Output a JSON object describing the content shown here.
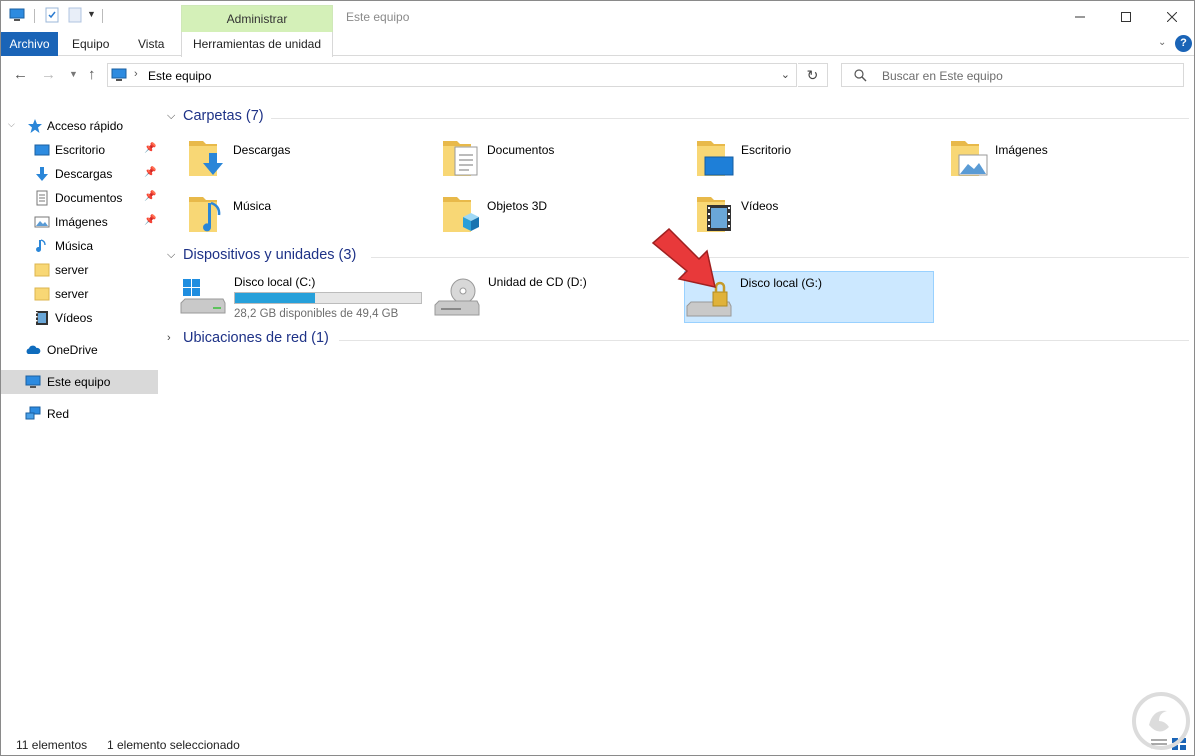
{
  "window": {
    "title": "Este equipo",
    "context_tab": "Administrar",
    "min_icon": "minimize-icon",
    "max_icon": "maximize-icon",
    "close_icon": "close-icon"
  },
  "ribbon": {
    "tabs": [
      "Archivo",
      "Equipo",
      "Vista",
      "Herramientas de unidad"
    ],
    "help": "?"
  },
  "address": {
    "location": "Este equipo",
    "search_placeholder": "Buscar en Este equipo"
  },
  "sidebar": {
    "quick_access": "Acceso rápido",
    "items": [
      {
        "label": "Escritorio",
        "icon": "desktop-icon",
        "pinned": true
      },
      {
        "label": "Descargas",
        "icon": "download-icon",
        "pinned": true
      },
      {
        "label": "Documentos",
        "icon": "documents-icon",
        "pinned": true
      },
      {
        "label": "Imágenes",
        "icon": "pictures-icon",
        "pinned": true
      },
      {
        "label": "Música",
        "icon": "music-icon",
        "pinned": false
      },
      {
        "label": "server",
        "icon": "folder-icon",
        "pinned": false
      },
      {
        "label": "server",
        "icon": "folder-icon",
        "pinned": false
      },
      {
        "label": "Vídeos",
        "icon": "videos-icon",
        "pinned": false
      }
    ],
    "onedrive": "OneDrive",
    "this_pc": "Este equipo",
    "network": "Red"
  },
  "content": {
    "folders_group": "Carpetas (7)",
    "folders": [
      {
        "label": "Descargas",
        "icon": "downloads-folder-icon"
      },
      {
        "label": "Documentos",
        "icon": "documents-folder-icon"
      },
      {
        "label": "Escritorio",
        "icon": "desktop-folder-icon"
      },
      {
        "label": "Imágenes",
        "icon": "pictures-folder-icon"
      },
      {
        "label": "Música",
        "icon": "music-folder-icon"
      },
      {
        "label": "Objetos 3D",
        "icon": "3d-objects-folder-icon"
      },
      {
        "label": "Vídeos",
        "icon": "videos-folder-icon"
      }
    ],
    "devices_group": "Dispositivos y unidades (3)",
    "drives": [
      {
        "label": "Disco local (C:)",
        "free_text": "28,2 GB disponibles de 49,4 GB",
        "used_fraction": 0.43,
        "icon": "windows-drive-icon"
      },
      {
        "label": "Unidad de CD (D:)",
        "icon": "cd-drive-icon"
      },
      {
        "label": "Disco local (G:)",
        "icon": "locked-drive-icon",
        "selected": true
      }
    ],
    "network_group": "Ubicaciones de red (1)"
  },
  "status": {
    "count": "11 elementos",
    "selection": "1 elemento seleccionado"
  },
  "colors": {
    "accent": "#1a64b7",
    "context_tab": "#d4f0b8",
    "selection": "#cce8ff",
    "group_title": "#1e3287",
    "arrow": "#e8393a"
  }
}
